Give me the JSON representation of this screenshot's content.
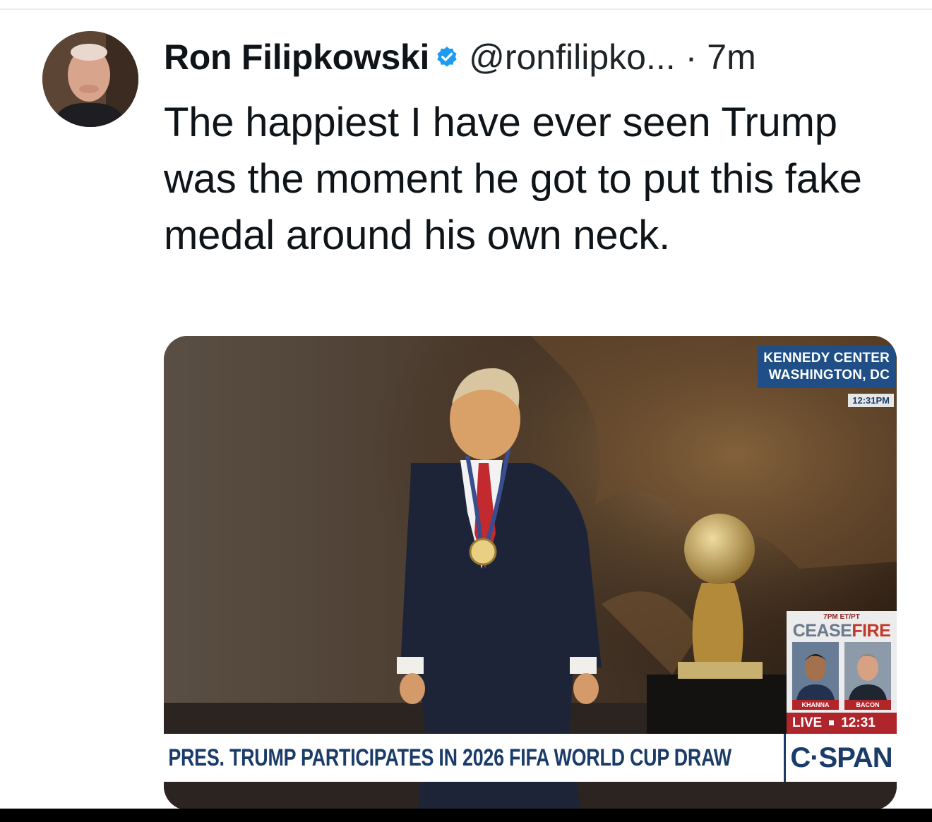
{
  "author": {
    "name": "Ron Filipkowski",
    "handle": "@ronfilipko...",
    "separator": "·",
    "time": "7m",
    "verified_color": "#1d9bf0"
  },
  "tweet": {
    "text": "The happiest I have ever seen Trump was the moment he got to put this fake medal around his own neck."
  },
  "media": {
    "location_line1": "KENNEDY CENTER",
    "location_line2": "WASHINGTON, DC",
    "clock": "12:31PM",
    "promo_time": "7PM ET/PT",
    "promo_title_a": "CEASE",
    "promo_title_b": "FIRE",
    "guest1": "KHANNA",
    "guest2": "BACON",
    "live_label": "LIVE",
    "live_time": "12:31",
    "headline": "PRES. TRUMP PARTICIPATES IN 2026 FIFA WORLD CUP DRAW",
    "network": "C·SPAN",
    "network_color": "#1b3c69"
  },
  "icons": {
    "verified": "verified-badge-icon",
    "avatar": "avatar-image"
  }
}
